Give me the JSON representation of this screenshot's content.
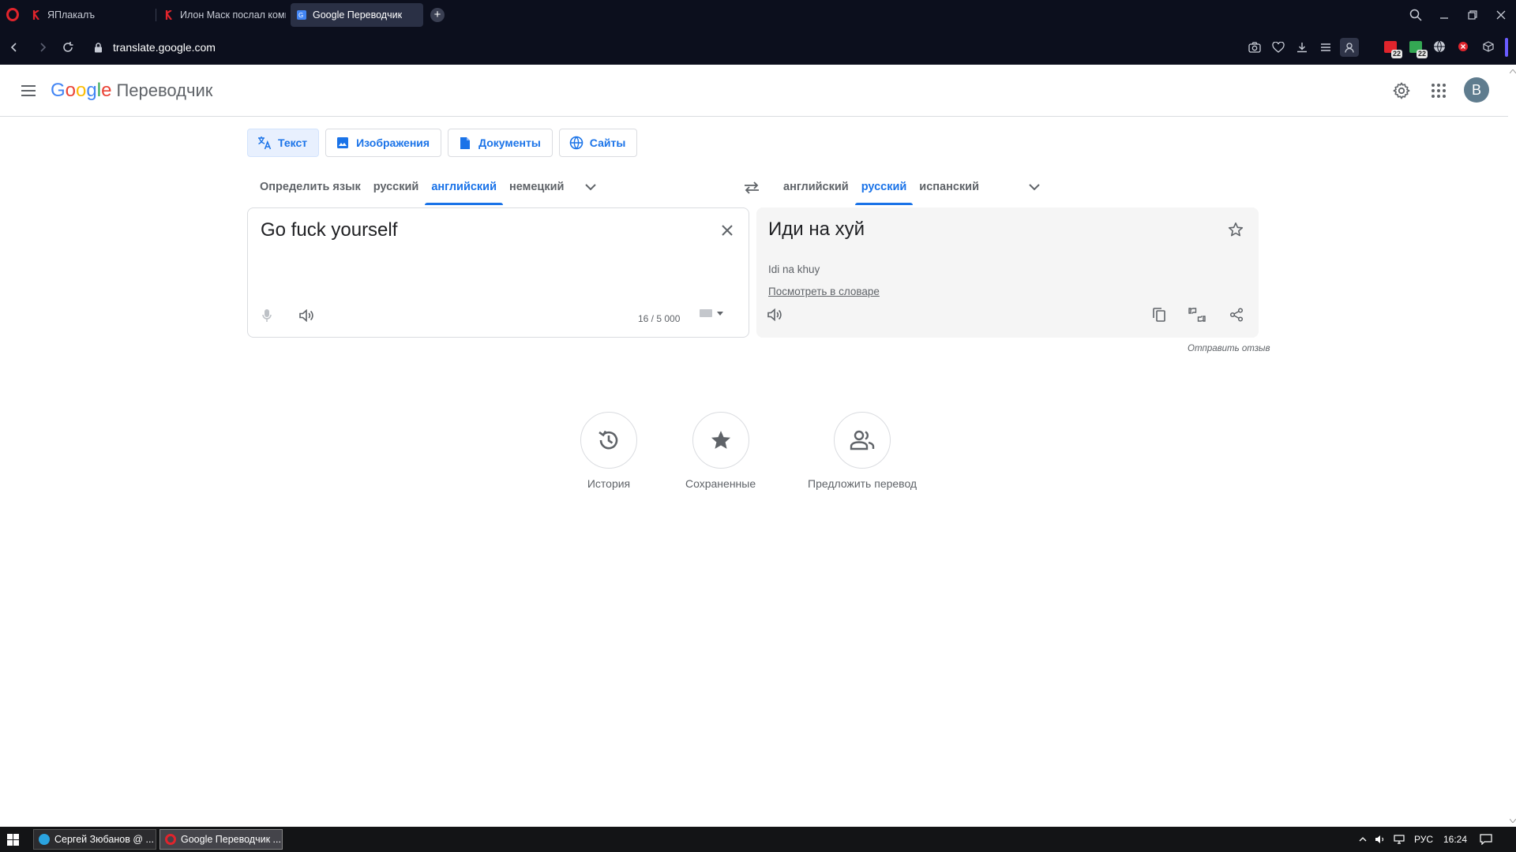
{
  "browser": {
    "tabs": [
      {
        "label": "ЯПлакалъ"
      },
      {
        "label": "Илон Маск послал комп"
      },
      {
        "label": "Google Переводчик"
      }
    ],
    "url_host": "translate.google.com",
    "extension_badges": [
      "22",
      "22"
    ]
  },
  "header": {
    "logo_letters": [
      "G",
      "o",
      "o",
      "g",
      "l",
      "e"
    ],
    "logo_colors": [
      "#4285F4",
      "#EA4335",
      "#FBBC05",
      "#4285F4",
      "#34A853",
      "#EA4335"
    ],
    "product": "Переводчик",
    "avatar_letter": "B"
  },
  "modes": [
    {
      "label": "Текст",
      "icon": "translate-icon"
    },
    {
      "label": "Изображения",
      "icon": "image-icon"
    },
    {
      "label": "Документы",
      "icon": "document-icon"
    },
    {
      "label": "Сайты",
      "icon": "globe-icon"
    }
  ],
  "source_langs": [
    {
      "label": "Определить язык",
      "active": false
    },
    {
      "label": "русский",
      "active": false
    },
    {
      "label": "английский",
      "active": true
    },
    {
      "label": "немецкий",
      "active": false
    }
  ],
  "target_langs": [
    {
      "label": "английский",
      "active": false
    },
    {
      "label": "русский",
      "active": true
    },
    {
      "label": "испанский",
      "active": false
    }
  ],
  "source": {
    "text": "Go fuck yourself",
    "counter": "16 / 5 000"
  },
  "target": {
    "text": "Иди на хуй",
    "transliteration": "Idi na khuy",
    "dictionary_link": "Посмотреть в словаре"
  },
  "feedback": "Отправить отзыв",
  "quick_actions": [
    {
      "label": "История",
      "icon": "history-icon"
    },
    {
      "label": "Сохраненные",
      "icon": "star-icon"
    },
    {
      "label": "Предложить перевод",
      "icon": "people-icon"
    }
  ],
  "taskbar": {
    "items": [
      {
        "label": "Сергей Зюбанов @ ..."
      },
      {
        "label": "Google Переводчик ..."
      }
    ],
    "language": "РУС",
    "clock": "16:24"
  },
  "colors": {
    "accent": "#1a73e8",
    "chrome_bg": "#0c0f1d",
    "taskbar_bg": "#131416"
  }
}
